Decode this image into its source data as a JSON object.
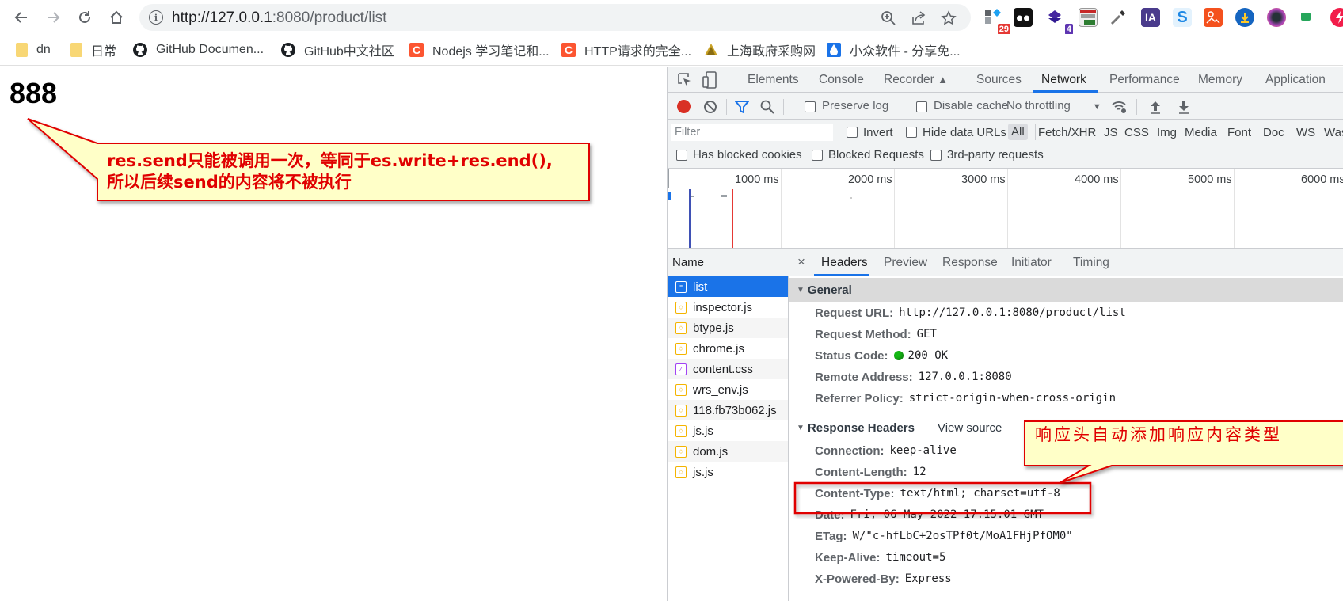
{
  "browser": {
    "url_scheme_host": "http://127.0.0.1",
    "url_rest": ":8080/product/list",
    "nav": {
      "back_icon": "arrow-left-icon",
      "forward_icon": "arrow-right-icon",
      "reload_icon": "reload-icon",
      "home_icon": "home-icon"
    },
    "omnibox_actions": [
      "zoom-icon",
      "share-icon",
      "star-icon"
    ],
    "extensions": [
      {
        "name": "extension-1",
        "badge": "29"
      },
      {
        "name": "extension-2",
        "badge": ""
      },
      {
        "name": "extension-3",
        "badge": "4"
      },
      {
        "name": "extension-4",
        "badge": ""
      },
      {
        "name": "extension-eyedropper",
        "badge": ""
      },
      {
        "name": "extension-ia",
        "label": "IA",
        "badge": ""
      },
      {
        "name": "extension-s",
        "label": "S",
        "badge": ""
      },
      {
        "name": "extension-image",
        "badge": ""
      },
      {
        "name": "extension-download",
        "badge": ""
      },
      {
        "name": "extension-camera",
        "badge": ""
      },
      {
        "name": "extension-green",
        "badge": ""
      },
      {
        "name": "extension-bolt",
        "badge": ""
      }
    ]
  },
  "bookmarks": [
    {
      "label": "dn",
      "icon": "folder-icon"
    },
    {
      "label": "日常",
      "icon": "folder-icon"
    },
    {
      "label": "GitHub Documen...",
      "icon": "github-icon"
    },
    {
      "label": "GitHub中文社区",
      "icon": "github-icon"
    },
    {
      "label": "Nodejs 学习笔记和...",
      "icon": "csdn-icon"
    },
    {
      "label": "HTTP请求的完全...",
      "icon": "csdn-icon"
    },
    {
      "label": "上海政府采购网",
      "icon": "gov-icon"
    },
    {
      "label": "小众软件 - 分享免...",
      "icon": "drop-icon"
    }
  ],
  "page": {
    "body_text": "888"
  },
  "annotations": {
    "callout_1_line1": "res.send只能被调用一次，等同于es.write+res.end(),",
    "callout_1_line2": "所以后续send的内容将不被执行",
    "callout_2": "响应头自动添加响应内容类型"
  },
  "devtools": {
    "tabs": [
      "Elements",
      "Console",
      "Recorder",
      "Sources",
      "Network",
      "Performance",
      "Memory",
      "Application"
    ],
    "active_tab": "Network",
    "toolbar": {
      "preserve_log": "Preserve log",
      "disable_cache": "Disable cache",
      "throttling": "No throttling"
    },
    "filter": {
      "placeholder": "Filter",
      "invert": "Invert",
      "hide_data_urls": "Hide data URLs",
      "types": [
        "All",
        "Fetch/XHR",
        "JS",
        "CSS",
        "Img",
        "Media",
        "Font",
        "Doc",
        "WS",
        "Wasm"
      ],
      "active_type": "All",
      "has_blocked_cookies": "Has blocked cookies",
      "blocked_requests": "Blocked Requests",
      "third_party": "3rd-party requests"
    },
    "timeline": {
      "ticks": [
        "1000 ms",
        "2000 ms",
        "3000 ms",
        "4000 ms",
        "5000 ms",
        "6000 ms"
      ]
    },
    "requests": {
      "header": "Name",
      "items": [
        {
          "name": "list",
          "type": "doc",
          "selected": true
        },
        {
          "name": "inspector.js",
          "type": "js"
        },
        {
          "name": "btype.js",
          "type": "js"
        },
        {
          "name": "chrome.js",
          "type": "js"
        },
        {
          "name": "content.css",
          "type": "css"
        },
        {
          "name": "wrs_env.js",
          "type": "js"
        },
        {
          "name": "118.fb73b062.js",
          "type": "js"
        },
        {
          "name": "js.js",
          "type": "js"
        },
        {
          "name": "dom.js",
          "type": "js"
        },
        {
          "name": "js.js",
          "type": "js"
        }
      ]
    },
    "details": {
      "close": "×",
      "tabs": [
        "Headers",
        "Preview",
        "Response",
        "Initiator",
        "Timing"
      ],
      "active_tab": "Headers",
      "general": {
        "title": "General",
        "rows": [
          {
            "key": "Request URL:",
            "value": "http://127.0.0.1:8080/product/list"
          },
          {
            "key": "Request Method:",
            "value": "GET"
          },
          {
            "key": "Status Code:",
            "value": "200 OK",
            "status_color": "#14b814"
          },
          {
            "key": "Remote Address:",
            "value": "127.0.0.1:8080"
          },
          {
            "key": "Referrer Policy:",
            "value": "strict-origin-when-cross-origin"
          }
        ]
      },
      "response_headers": {
        "title": "Response Headers",
        "view_source": "View source",
        "rows": [
          {
            "key": "Connection:",
            "value": "keep-alive"
          },
          {
            "key": "Content-Length:",
            "value": "12"
          },
          {
            "key": "Content-Type:",
            "value": "text/html; charset=utf-8"
          },
          {
            "key": "Date:",
            "value": "Fri, 06 May 2022 17:15:01 GMT"
          },
          {
            "key": "ETag:",
            "value": "W/\"c-hfLbC+2osTPf0t/MoA1FHjPfOM0\""
          },
          {
            "key": "Keep-Alive:",
            "value": "timeout=5"
          },
          {
            "key": "X-Powered-By:",
            "value": "Express"
          }
        ]
      }
    }
  },
  "colors": {
    "accent": "#1a73e8",
    "annotation_red": "#e00000",
    "annotation_fill": "#ffffc8",
    "record_red": "#d93025"
  }
}
